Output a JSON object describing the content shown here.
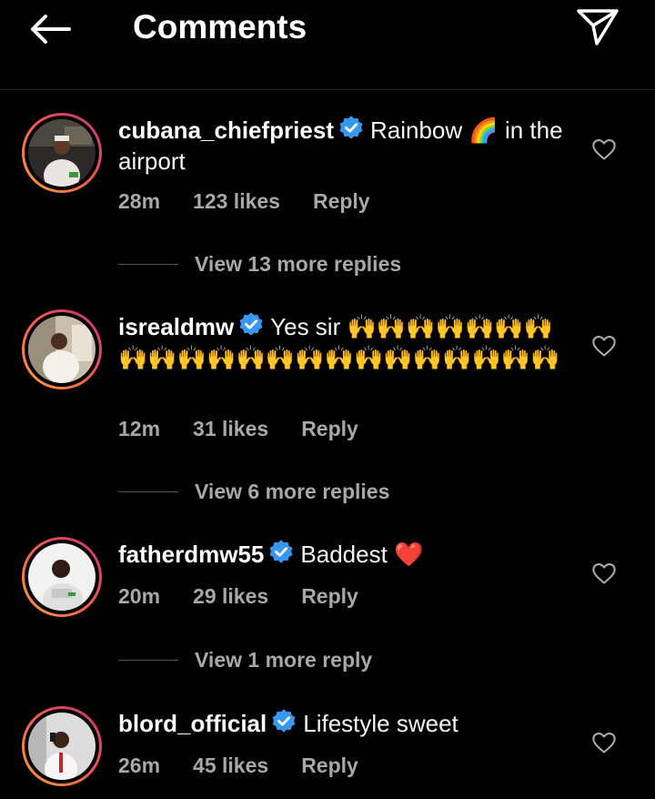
{
  "header": {
    "title": "Comments"
  },
  "comments": [
    {
      "username": "cubana_chiefpriest",
      "text": "Rainbow 🌈 in the airport",
      "time": "28m",
      "likes": "123 likes",
      "reply": "Reply",
      "view_replies": "View 13 more replies"
    },
    {
      "username": "isrealdmw",
      "text": "Yes sir 🙌🙌🙌🙌🙌🙌🙌🙌🙌🙌🙌🙌🙌🙌🙌🙌🙌🙌🙌🙌🙌🙌",
      "time": "12m",
      "likes": "31 likes",
      "reply": "Reply",
      "view_replies": "View 6 more replies"
    },
    {
      "username": "fatherdmw55",
      "text": "Baddest ❤️",
      "time": "20m",
      "likes": "29 likes",
      "reply": "Reply",
      "view_replies": "View 1 more reply"
    },
    {
      "username": "blord_official",
      "text": "Lifestyle sweet",
      "time": "26m",
      "likes": "45 likes",
      "reply": "Reply"
    }
  ],
  "icons": {
    "back": "arrow-left-icon",
    "share": "paper-plane-icon",
    "verified": "verified-badge-icon",
    "like": "heart-outline-icon"
  },
  "colors": {
    "background": "#000000",
    "verified": "#3897f0",
    "secondary_text": "#a8a8a8"
  }
}
